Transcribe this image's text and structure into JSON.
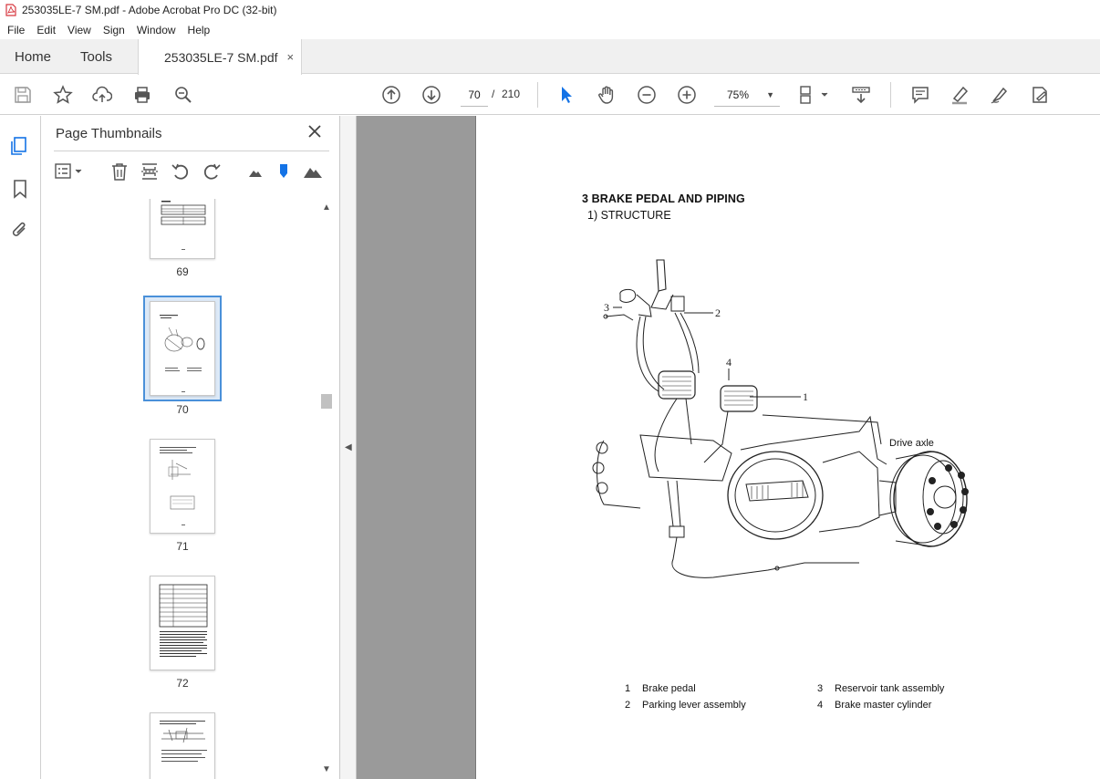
{
  "window": {
    "title": "253035LE-7 SM.pdf - Adobe Acrobat Pro DC (32-bit)"
  },
  "menu": [
    "File",
    "Edit",
    "View",
    "Sign",
    "Window",
    "Help"
  ],
  "tabs": {
    "home": "Home",
    "tools": "Tools",
    "document": "253035LE-7 SM.pdf",
    "document_close": "×"
  },
  "toolbar": {
    "current_page": "70",
    "page_separator": "/",
    "total_pages": "210",
    "zoom": "75%"
  },
  "thumbnails_panel": {
    "title": "Page Thumbnails",
    "pages": [
      {
        "label": "69",
        "selected": false
      },
      {
        "label": "70",
        "selected": true
      },
      {
        "label": "71",
        "selected": false
      },
      {
        "label": "72",
        "selected": false
      },
      {
        "label": "",
        "selected": false
      }
    ]
  },
  "document": {
    "heading": "3   BRAKE PEDAL AND PIPING",
    "subheading": "1)  STRUCTURE",
    "figure_label": "Drive axle",
    "callouts": [
      "1",
      "2",
      "3",
      "4"
    ],
    "legend": [
      {
        "num": "1",
        "text": "Brake pedal"
      },
      {
        "num": "2",
        "text": "Parking lever assembly"
      },
      {
        "num": "3",
        "text": "Reservoir tank assembly"
      },
      {
        "num": "4",
        "text": "Brake master cylinder"
      }
    ]
  },
  "colors": {
    "accent": "#1473e6",
    "doc_background": "#9a9a9a",
    "selection": "#4a90d9"
  }
}
